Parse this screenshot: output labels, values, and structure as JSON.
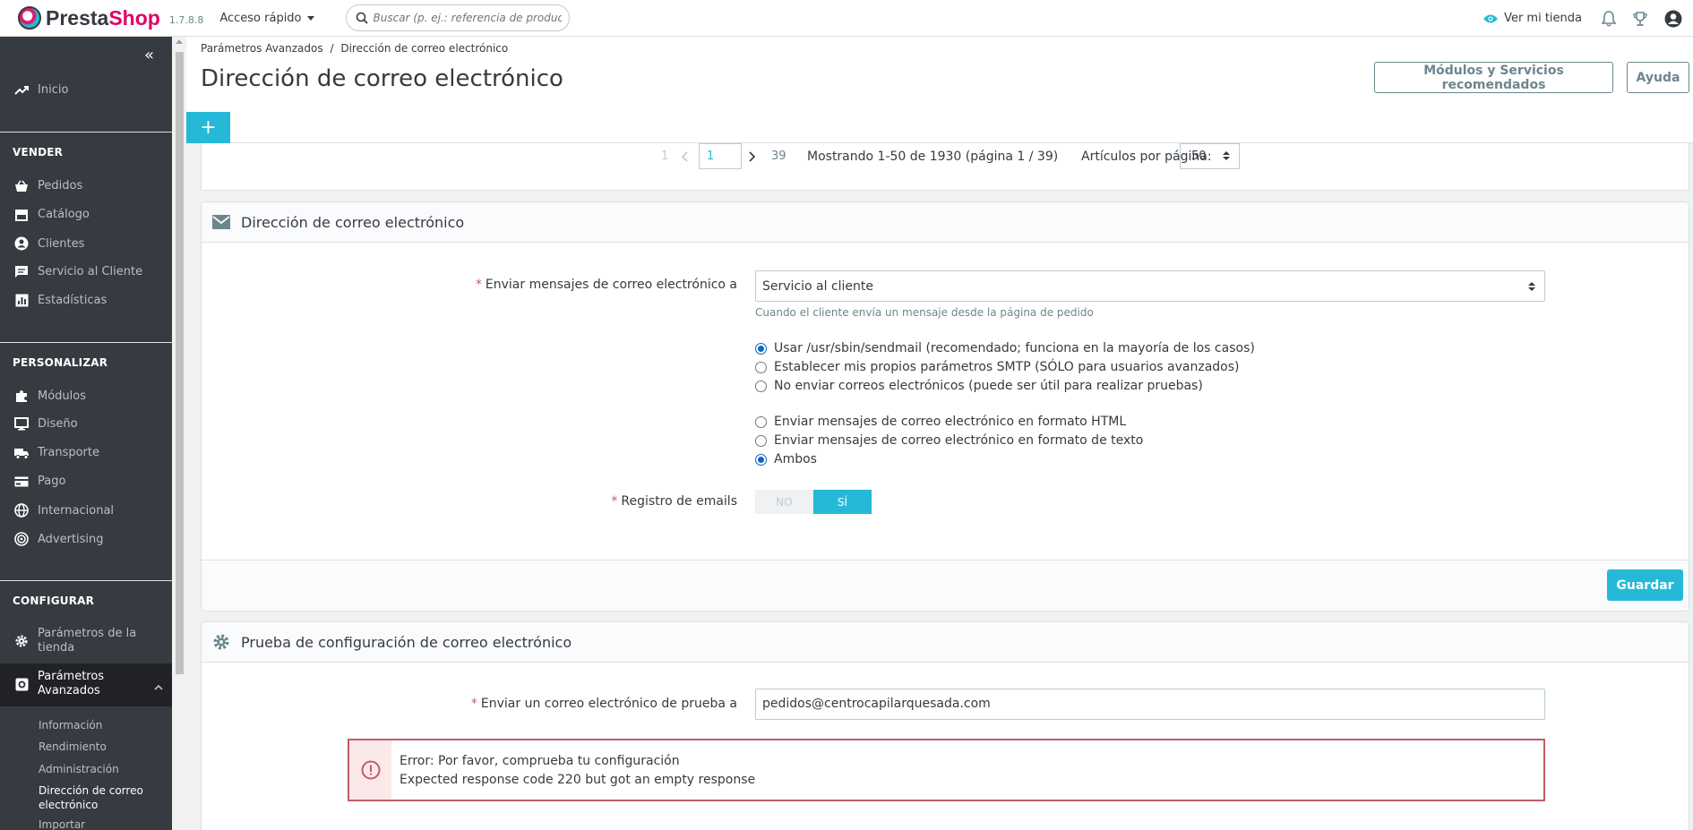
{
  "header": {
    "logo_text_a": "Presta",
    "logo_text_b": "Shop",
    "version": "1.7.8.8",
    "quick_access": "Acceso rápido",
    "search_placeholder": "Buscar (p. ej.: referencia de producto, no",
    "view_shop": "Ver mi tienda"
  },
  "sidebar": {
    "inicio": "Inicio",
    "sec_vender": "VENDER",
    "pedidos": "Pedidos",
    "catalogo": "Catálogo",
    "clientes": "Clientes",
    "servicio": "Servicio al Cliente",
    "estadisticas": "Estadísticas",
    "sec_personalizar": "PERSONALIZAR",
    "modulos": "Módulos",
    "diseno": "Diseño",
    "transporte": "Transporte",
    "pago": "Pago",
    "internacional": "Internacional",
    "advertising": "Advertising",
    "sec_configurar": "CONFIGURAR",
    "param_tienda_1": "Parámetros de la",
    "param_tienda_2": "tienda",
    "param_av_1": "Parámetros",
    "param_av_2": "Avanzados",
    "sub_informacion": "Información",
    "sub_rendimiento": "Rendimiento",
    "sub_administracion": "Administración",
    "sub_direccion_1": "Dirección de correo",
    "sub_direccion_2": "electrónico",
    "sub_importar": "Importar"
  },
  "toolbar": {
    "breadcrumb_parent": "Parámetros Avanzados",
    "breadcrumb_sep": "/",
    "breadcrumb_current": "Dirección de correo electrónico",
    "title": "Dirección de correo electrónico",
    "btn_modules": "Módulos y Servicios recomendados",
    "btn_help": "Ayuda",
    "add_tab": "+"
  },
  "pagination": {
    "first": "1",
    "current": "1",
    "last": "39",
    "showing": "Mostrando 1-50 de 1930 (página 1 / 39)",
    "per_page_label": "Artículos por página:",
    "per_page_value": "50"
  },
  "email_panel": {
    "title": "Dirección de correo electrónico",
    "send_to_label": "Enviar mensajes de correo electrónico a",
    "send_to_value": "Servicio al cliente",
    "send_to_help": "Cuando el cliente envía un mensaje desde la página de pedido",
    "method_sendmail": "Usar /usr/sbin/sendmail (recomendado; funciona en la mayoría de los casos)",
    "method_smtp": "Establecer mis propios parámetros SMTP (SÓLO para usuarios avanzados)",
    "method_none": "No enviar correos electrónicos (puede ser útil para realizar pruebas)",
    "format_html": "Enviar mensajes de correo electrónico en formato HTML",
    "format_text": "Enviar mensajes de correo electrónico en formato de texto",
    "format_both": "Ambos",
    "log_label": "Registro de emails",
    "log_no": "NO",
    "log_yes": "SÍ",
    "save": "Guardar"
  },
  "test_panel": {
    "title": "Prueba de configuración de correo electrónico",
    "test_label": "Enviar un correo electrónico de prueba a",
    "test_value": "pedidos@centrocapilarquesada.com",
    "error_line1": "Error: Por favor, comprueba tu configuración",
    "error_line2": "Expected response code 220 but got an empty response"
  },
  "colors": {
    "accent": "#25b9d7",
    "sidebar_bg": "#363a41",
    "error": "#c05c67",
    "brand_pink": "#df0067"
  }
}
